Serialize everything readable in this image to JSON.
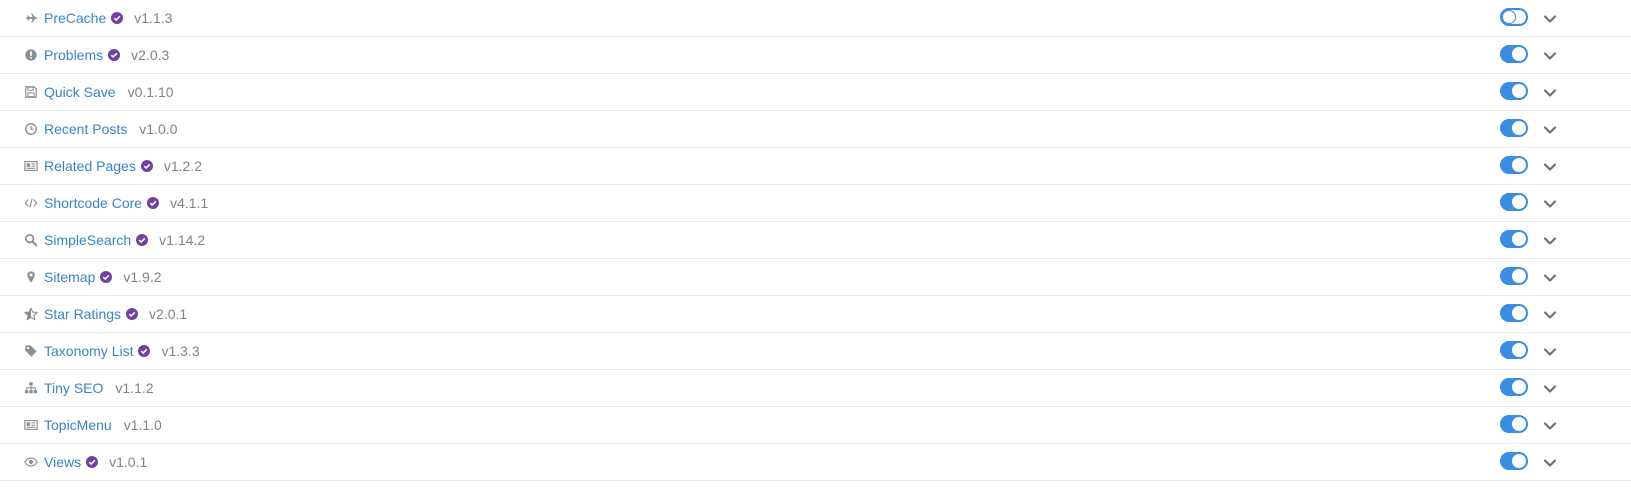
{
  "colors": {
    "link": "#3a84c4",
    "version": "#7d8489",
    "icon": "#8a9196",
    "verified": "#6f42a1",
    "toggle_on": "#3a8de0",
    "divider": "#e9ecef"
  },
  "plugins": [
    {
      "name": "PreCache",
      "version": "v1.1.3",
      "icon": "plane-icon",
      "verified": true,
      "enabled": false
    },
    {
      "name": "Problems",
      "version": "v2.0.3",
      "icon": "exclamation-circle-icon",
      "verified": true,
      "enabled": true
    },
    {
      "name": "Quick Save",
      "version": "v0.1.10",
      "icon": "floppy-disk-icon",
      "verified": false,
      "enabled": true
    },
    {
      "name": "Recent Posts",
      "version": "v1.0.0",
      "icon": "clock-icon",
      "verified": false,
      "enabled": true
    },
    {
      "name": "Related Pages",
      "version": "v1.2.2",
      "icon": "newspaper-icon",
      "verified": true,
      "enabled": true
    },
    {
      "name": "Shortcode Core",
      "version": "v4.1.1",
      "icon": "code-icon",
      "verified": true,
      "enabled": true
    },
    {
      "name": "SimpleSearch",
      "version": "v1.14.2",
      "icon": "search-icon",
      "verified": true,
      "enabled": true
    },
    {
      "name": "Sitemap",
      "version": "v1.9.2",
      "icon": "map-marker-icon",
      "verified": true,
      "enabled": true
    },
    {
      "name": "Star Ratings",
      "version": "v2.0.1",
      "icon": "star-half-icon",
      "verified": true,
      "enabled": true
    },
    {
      "name": "Taxonomy List",
      "version": "v1.3.3",
      "icon": "tag-icon",
      "verified": true,
      "enabled": true
    },
    {
      "name": "Tiny SEO",
      "version": "v1.1.2",
      "icon": "sitemap-icon",
      "verified": false,
      "enabled": true
    },
    {
      "name": "TopicMenu",
      "version": "v1.1.0",
      "icon": "newspaper-icon",
      "verified": false,
      "enabled": true
    },
    {
      "name": "Views",
      "version": "v1.0.1",
      "icon": "eye-icon",
      "verified": true,
      "enabled": true
    }
  ]
}
